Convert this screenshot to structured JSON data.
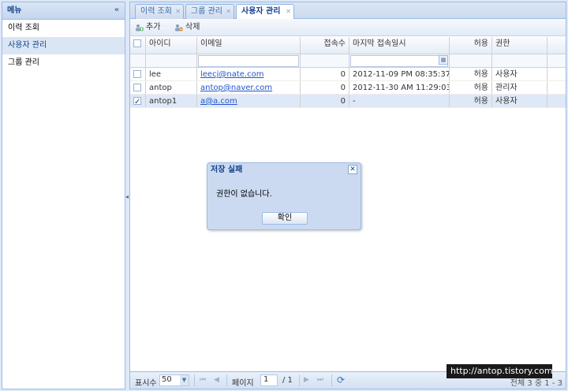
{
  "sidebar": {
    "title": "메뉴",
    "collapse_glyph": "«",
    "items": [
      {
        "label": "이력 조회"
      },
      {
        "label": "사용자 관리"
      },
      {
        "label": "그룹 관리"
      }
    ]
  },
  "tabs": [
    {
      "label": "이력 조회"
    },
    {
      "label": "그룹 관리"
    },
    {
      "label": "사용자 관리"
    }
  ],
  "toolbar": {
    "add_label": "추가",
    "delete_label": "삭제"
  },
  "grid": {
    "columns": [
      "아이디",
      "이메일",
      "접속수",
      "마지막 접속일시",
      "허용",
      "권한"
    ],
    "rows": [
      {
        "checked": false,
        "id": "lee",
        "email": "leecj@nate.com",
        "count": "0",
        "last_access": "2012-11-09 PM 08:35:37",
        "allowed": "허용",
        "role": "사용자"
      },
      {
        "checked": false,
        "id": "antop",
        "email": "antop@naver.com",
        "count": "0",
        "last_access": "2012-11-30 AM 11:29:03",
        "allowed": "허용",
        "role": "관리자"
      },
      {
        "checked": true,
        "id": "antop1",
        "email": "a@a.com",
        "count": "0",
        "last_access": "-",
        "allowed": "허용",
        "role": "사용자"
      }
    ]
  },
  "pager": {
    "page_size_label": "표시수",
    "page_size_value": "50",
    "page_label": "페이지",
    "page_value": "1",
    "page_total": "/ 1",
    "summary": "전체 3 중 1 - 3"
  },
  "dialog": {
    "title": "저장 실패",
    "message": "권한이 없습니다.",
    "ok_label": "확인"
  },
  "watermark": "http://antop.tistory.com",
  "colors": {
    "panel_border": "#99bbe8",
    "header_text": "#15428b",
    "selected_row": "#dfe8f6",
    "link": "#2255cc"
  }
}
